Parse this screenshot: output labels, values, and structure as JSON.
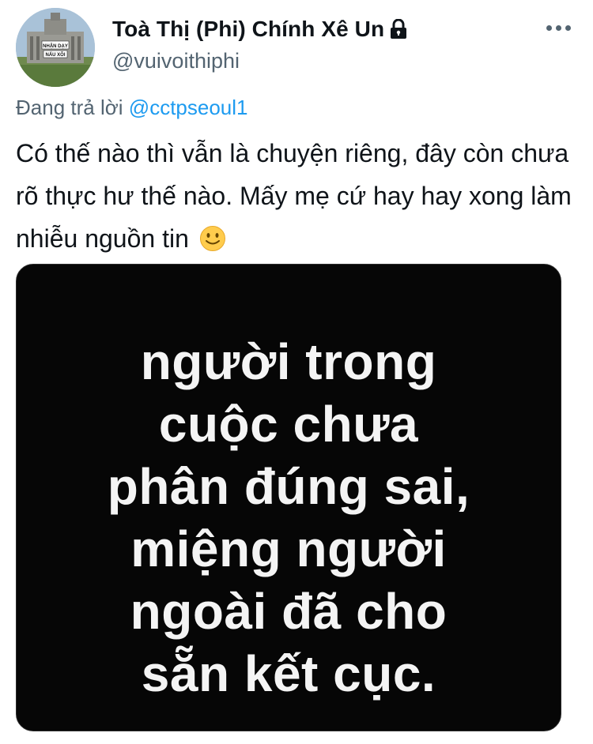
{
  "tweet": {
    "display_name": "Toà Thị (Phi) Chính Xê Un",
    "handle": "@vuivoithiphi",
    "reply_prefix": "Đang trả lời",
    "reply_to": "@cctpseoul1",
    "text": "Có thế nào thì vẫn là chuyện riêng, đây còn chưa rõ thực hư thế nào. Mấy mẹ cứ hay hay xong làm nhiễu nguồn tin",
    "emoji": "slightly-smiling-face",
    "avatar_sign_text": [
      "NHẬN DẠY",
      "NẤU XÔI"
    ],
    "image_text_lines": [
      "người trong",
      "cuộc chưa",
      "phân đúng sai,",
      "miệng người",
      "ngoài đã cho",
      "sẵn kết cục."
    ]
  },
  "icons": {
    "lock": "lock-icon",
    "more": "more-options-icon",
    "emoji": "smiley-emoji-icon"
  },
  "colors": {
    "text_primary": "#0f1419",
    "text_secondary": "#536471",
    "link": "#1d9bf0",
    "media_background": "#060606",
    "media_text": "#f4f4f4"
  }
}
